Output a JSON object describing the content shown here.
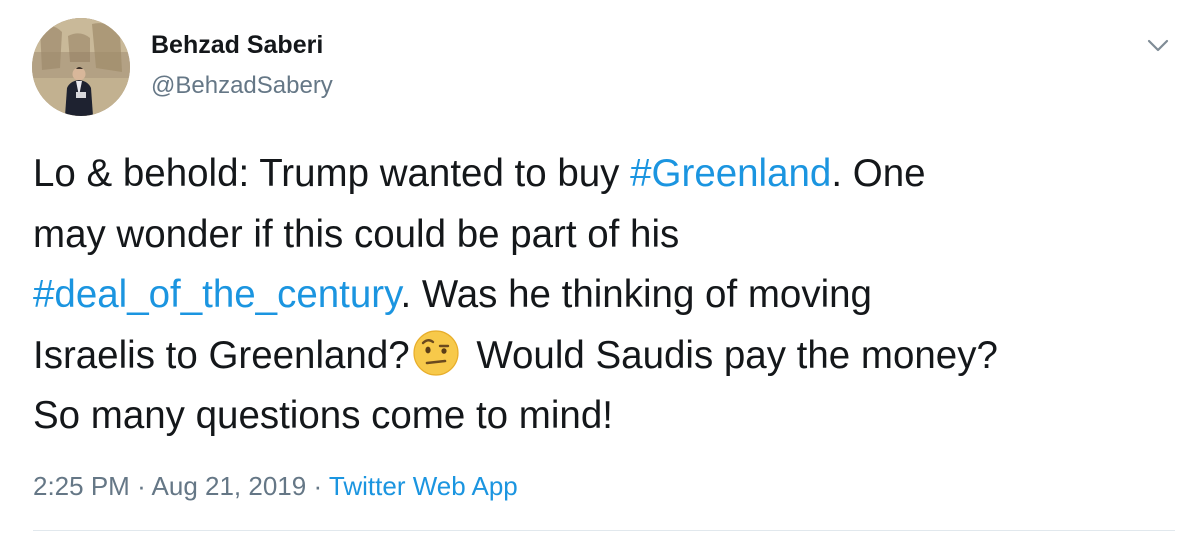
{
  "author": {
    "display_name": "Behzad Saberi",
    "handle": "@BehzadSabery",
    "avatar_icon": "profile-photo"
  },
  "menu": {
    "icon": "chevron-down-icon"
  },
  "tweet": {
    "lines": [
      {
        "pre": "Lo & behold: Trump wanted to buy ",
        "tag": "#Greenland",
        "post": ". One"
      },
      {
        "text": "may wonder if this could be part of his"
      },
      {
        "tag": "#deal_of_the_century",
        "post": ". Was he thinking of moving"
      },
      {
        "pre": "Israelis to Greenland?",
        "emoji": "face-with-raised-eyebrow",
        "post": " Would Saudis pay the money?"
      },
      {
        "text": "So many questions come to mind!"
      }
    ]
  },
  "meta": {
    "time": "2:25 PM",
    "separator": "·",
    "date": "Aug 21, 2019",
    "source": "Twitter Web App"
  },
  "colors": {
    "link": "#1b95e0",
    "text": "#14171a",
    "secondary": "#657786",
    "divider": "#e1e8ed"
  }
}
